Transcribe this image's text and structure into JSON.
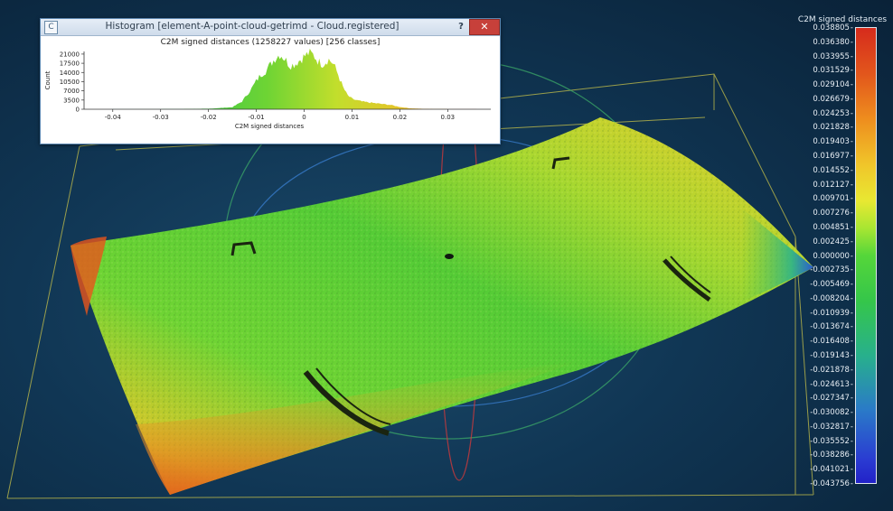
{
  "histogram_window": {
    "title": "Histogram [element-A-point-cloud-getrimd - Cloud.registered]",
    "heading": "C2M signed distances (1258227 values)  [256 classes]",
    "help_label": "?",
    "close_label": "✕",
    "app_icon_label": "C"
  },
  "chart_data": {
    "type": "bar",
    "title": "C2M signed distances (1258227 values)  [256 classes]",
    "xlabel": "C2M signed distances",
    "ylabel": "Count",
    "xlim": [
      -0.046,
      0.039
    ],
    "ylim": [
      0,
      22000
    ],
    "yticks": [
      0,
      3500,
      7000,
      10500,
      14000,
      17500,
      21000
    ],
    "xticks": [
      -0.04,
      -0.03,
      -0.02,
      -0.01,
      0,
      0.01,
      0.02,
      0.03
    ],
    "grid": false,
    "profile": [
      {
        "x": -0.046,
        "y": 0
      },
      {
        "x": -0.03,
        "y": 50
      },
      {
        "x": -0.02,
        "y": 200
      },
      {
        "x": -0.015,
        "y": 800
      },
      {
        "x": -0.013,
        "y": 3000
      },
      {
        "x": -0.011,
        "y": 8000
      },
      {
        "x": -0.01,
        "y": 11000
      },
      {
        "x": -0.009,
        "y": 13500
      },
      {
        "x": -0.008,
        "y": 15000
      },
      {
        "x": -0.007,
        "y": 17500
      },
      {
        "x": -0.006,
        "y": 20000
      },
      {
        "x": -0.005,
        "y": 21500
      },
      {
        "x": -0.004,
        "y": 19500
      },
      {
        "x": -0.003,
        "y": 17000
      },
      {
        "x": -0.002,
        "y": 17500
      },
      {
        "x": -0.001,
        "y": 19000
      },
      {
        "x": 0,
        "y": 20500
      },
      {
        "x": 0.001,
        "y": 21800
      },
      {
        "x": 0.002,
        "y": 21000
      },
      {
        "x": 0.003,
        "y": 18500
      },
      {
        "x": 0.004,
        "y": 17500
      },
      {
        "x": 0.005,
        "y": 19500
      },
      {
        "x": 0.006,
        "y": 18000
      },
      {
        "x": 0.007,
        "y": 14000
      },
      {
        "x": 0.008,
        "y": 9000
      },
      {
        "x": 0.009,
        "y": 5500
      },
      {
        "x": 0.01,
        "y": 4000
      },
      {
        "x": 0.012,
        "y": 3000
      },
      {
        "x": 0.015,
        "y": 2300
      },
      {
        "x": 0.018,
        "y": 1700
      },
      {
        "x": 0.02,
        "y": 900
      },
      {
        "x": 0.022,
        "y": 400
      },
      {
        "x": 0.025,
        "y": 150
      },
      {
        "x": 0.03,
        "y": 50
      },
      {
        "x": 0.039,
        "y": 0
      }
    ]
  },
  "color_scale": {
    "title": "C2M signed distances",
    "labels": [
      "0.038805",
      "0.036380",
      "0.033955",
      "0.031529",
      "0.029104",
      "0.026679",
      "0.024253",
      "0.021828",
      "0.019403",
      "0.016977",
      "0.014552",
      "0.012127",
      "0.009701",
      "0.007276",
      "0.004851",
      "0.002425",
      "0.000000",
      "-0.002735",
      "-0.005469",
      "-0.008204",
      "-0.010939",
      "-0.013674",
      "-0.016408",
      "-0.019143",
      "-0.021878",
      "-0.024613",
      "-0.027347",
      "-0.030082",
      "-0.032817",
      "-0.035552",
      "-0.038286",
      "-0.041021",
      "-0.043756"
    ]
  },
  "colors": {
    "background": "#0b2740",
    "bounding_box": "#c8c24a",
    "scale_red": "#d62b1c",
    "scale_green": "#4cd63a",
    "scale_blue": "#2222c8"
  }
}
